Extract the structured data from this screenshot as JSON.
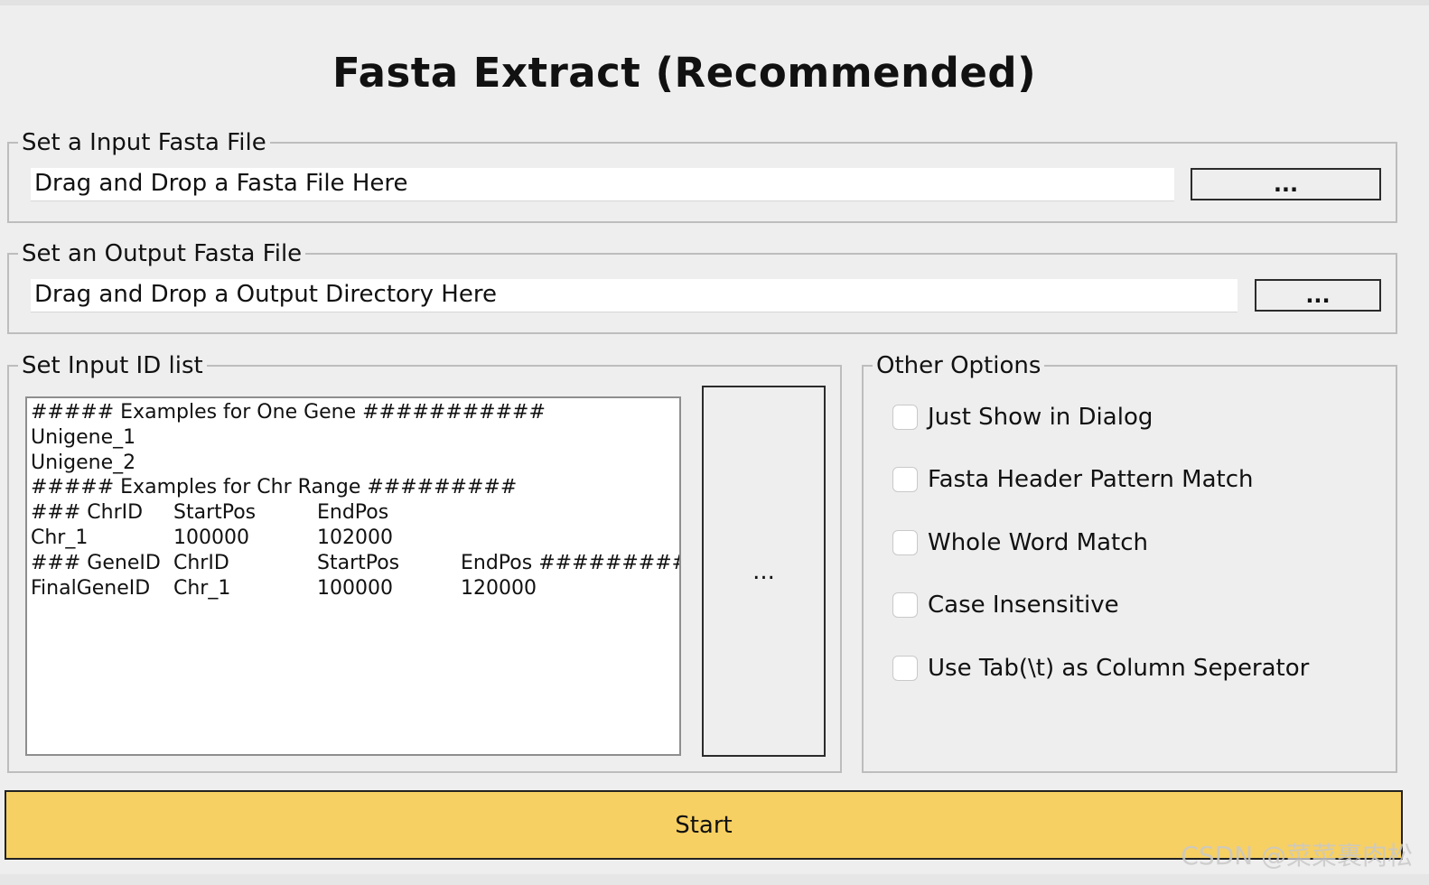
{
  "title": "Fasta Extract (Recommended)",
  "input_group": {
    "legend": "Set a Input Fasta File",
    "field_value": "Drag and Drop a Fasta File Here",
    "browse_label": "..."
  },
  "output_group": {
    "legend": "Set an Output Fasta File",
    "field_value": "Drag and Drop a Output Directory Here",
    "browse_label": "..."
  },
  "id_list_group": {
    "legend": "Set Input ID list",
    "browse_label": "...",
    "lines": [
      [
        "##### Examples for One Gene ###########"
      ],
      [
        "Unigene_1"
      ],
      [
        "Unigene_2"
      ],
      [
        "##### Examples for Chr Range #########"
      ],
      [
        "### ChrID",
        "StartPos",
        "EndPos"
      ],
      [
        "Chr_1",
        "100000",
        "102000"
      ],
      [
        "### GeneID",
        "ChrID",
        "StartPos",
        "EndPos #########"
      ],
      [
        "FinalGeneID",
        "Chr_1",
        "100000",
        "120000"
      ]
    ]
  },
  "options_group": {
    "legend": "Other Options",
    "options": [
      {
        "label": "Just Show in Dialog",
        "checked": false
      },
      {
        "label": "Fasta Header Pattern Match",
        "checked": false
      },
      {
        "label": "Whole Word Match",
        "checked": false
      },
      {
        "label": "Case Insensitive",
        "checked": false
      },
      {
        "label": "Use Tab(\\t) as Column Seperator",
        "checked": false
      }
    ]
  },
  "start_label": "Start",
  "watermark": "CSDN @菜菜裹肉松",
  "colors": {
    "background": "#eeeeee",
    "start_button": "#f7d063",
    "group_border": "#bdbdbd"
  }
}
